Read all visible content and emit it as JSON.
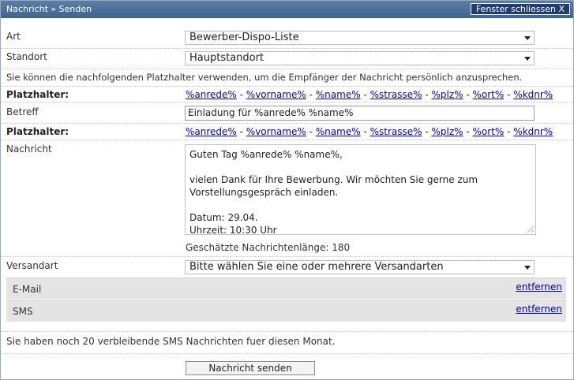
{
  "window": {
    "title": "Nachricht » Senden",
    "close_label": "Fenster schliessen X"
  },
  "form": {
    "art_label": "Art",
    "art_value": "Bewerber-Dispo-Liste",
    "standort_label": "Standort",
    "standort_value": "Hauptstandort",
    "hint": "Sie können die nachfolgenden Platzhalter verwenden, um die Empfänger der Nachricht persönlich anzusprechen.",
    "placeholder_label": "Platzhalter:",
    "placeholders": [
      "%anrede%",
      "%vorname%",
      "%name%",
      "%strasse%",
      "%plz%",
      "%ort%",
      "%kdnr%"
    ],
    "separator": " - ",
    "betreff_label": "Betreff",
    "betreff_value": "Einladung für %anrede% %name%",
    "nachricht_label": "Nachricht",
    "nachricht_value": "Guten Tag %anrede% %name%,\n\nvielen Dank für Ihre Bewerbung. Wir möchten Sie gerne zum Vorstellungsgespräch einladen.\n\nDatum: 29.04.\nUhrzeit: 10:30 Uhr",
    "length_text": "Geschätzte Nachrichtenlänge: 180",
    "versandart_label": "Versandart",
    "versandart_value": "Bitte wählen Sie eine oder mehrere Versandarten",
    "methods": [
      {
        "name": "E-Mail",
        "remove": "entfernen"
      },
      {
        "name": "SMS",
        "remove": "entfernen"
      }
    ],
    "sms_info": "Sie haben noch 20 verbleibende SMS Nachrichten fuer diesen Monat.",
    "send_label": "Nachricht senden"
  },
  "colors": {
    "titlebar": "#4a719b",
    "link": "#0000c0",
    "method_bg": "#e4e4e4"
  }
}
